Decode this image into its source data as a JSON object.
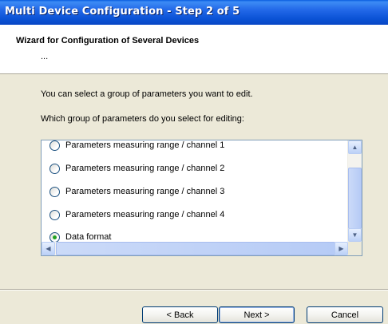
{
  "window": {
    "title": "Multi Device Configuration - Step 2 of 5"
  },
  "header": {
    "title": "Wizard for Configuration of Several Devices",
    "subtitle": "..."
  },
  "content": {
    "intro": "You can select a group of parameters you want to edit.",
    "question": "Which group of parameters do you select for editing:"
  },
  "list": {
    "items": [
      {
        "label": "Parameters measuring range / channel 1",
        "selected": false
      },
      {
        "label": "Parameters measuring range / channel 2",
        "selected": false
      },
      {
        "label": "Parameters measuring range / channel 3",
        "selected": false
      },
      {
        "label": "Parameters measuring range / channel 4",
        "selected": false
      },
      {
        "label": "Data format",
        "selected": true
      }
    ]
  },
  "buttons": {
    "back": "< Back",
    "next": "Next >",
    "cancel": "Cancel"
  }
}
